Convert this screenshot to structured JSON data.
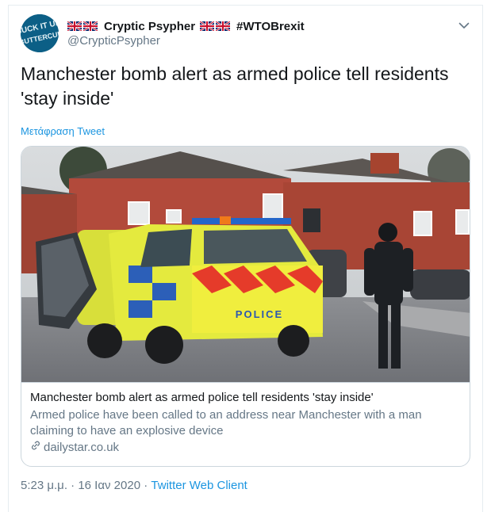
{
  "author": {
    "avatar_text": "SUCK IT UP BUTTERCUP",
    "display_name": "Cryptic Psypher",
    "hashtag": "#WTOBrexit",
    "handle": "@CrypticPsypher"
  },
  "tweet": {
    "text": "Manchester bomb alert as armed police tell residents 'stay inside'",
    "translate_label": "Μετάφραση Tweet"
  },
  "card": {
    "image_text": "POLICE",
    "title": "Manchester bomb alert as armed police tell residents 'stay inside'",
    "description": "Armed police have been called to an address near Manchester with a man claiming to have an explosive device",
    "domain": "dailystar.co.uk"
  },
  "meta": {
    "time": "5:23 μ.μ.",
    "separator": "·",
    "date": "16 Ιαν 2020",
    "client": "Twitter Web Client"
  },
  "colors": {
    "link_blue": "#1b95e0",
    "secondary_text": "#657786",
    "avatar_bg": "#0c5f86"
  },
  "icons": [
    "uk-flag-icon",
    "chevron-down-icon",
    "link-icon"
  ]
}
